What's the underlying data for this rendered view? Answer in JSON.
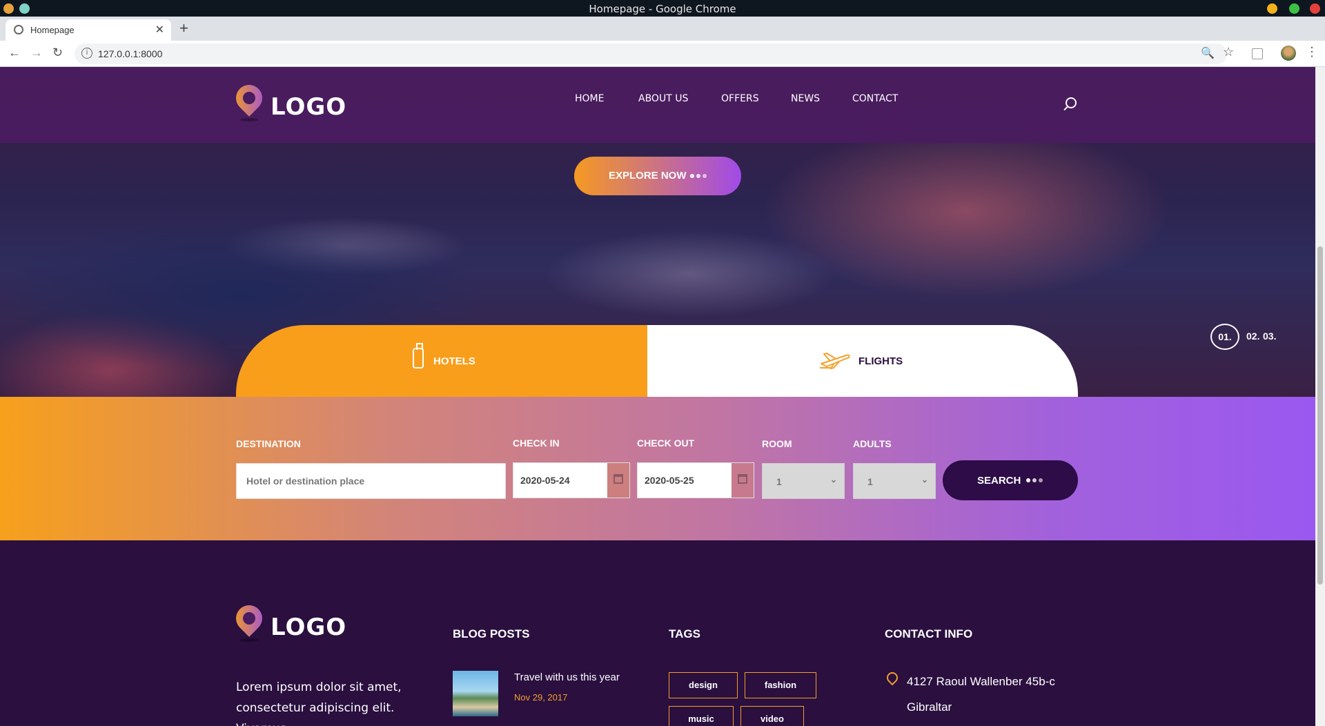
{
  "window": {
    "title": "Homepage - Google Chrome"
  },
  "browser": {
    "tab_title": "Homepage",
    "tab_close": "✕",
    "new_tab": "+",
    "url": "127.0.0.1:8000",
    "back": "←",
    "forward": "→",
    "reload": "↻",
    "zoom": "🔍",
    "star": "☆",
    "menu": "⋮"
  },
  "header": {
    "logo_text": "LOGO",
    "nav": [
      "HOME",
      "ABOUT US",
      "OFFERS",
      "NEWS",
      "CONTACT"
    ]
  },
  "hero": {
    "explore_label": "EXPLORE NOW",
    "slides": [
      "01.",
      "02.",
      "03."
    ]
  },
  "booking_tabs": {
    "hotels": "HOTELS",
    "flights": "FLIGHTS"
  },
  "search_form": {
    "destination_label": "DESTINATION",
    "destination_placeholder": "Hotel or destination place",
    "checkin_label": "CHECK IN",
    "checkin_value": "2020-05-24",
    "checkout_label": "CHECK OUT",
    "checkout_value": "2020-05-25",
    "room_label": "ROOM",
    "room_value": "1",
    "adults_label": "ADULTS",
    "adults_value": "1",
    "search_label": "SEARCH"
  },
  "footer": {
    "logo_text": "LOGO",
    "about_text": "Lorem ipsum dolor sit amet, consectetur adipiscing elit. Vivamus",
    "blog_heading": "BLOG POSTS",
    "blog_post_title": "Travel with us this year",
    "blog_post_date": "Nov 29, 2017",
    "tags_heading": "TAGS",
    "tags": [
      "design",
      "fashion",
      "music",
      "video"
    ],
    "contact_heading": "CONTACT INFO",
    "address_line1": "4127 Raoul Wallenber 45b-c",
    "address_line2": "Gibraltar"
  },
  "colors": {
    "accent_orange": "#f99e1b",
    "accent_purple": "#9b58f0",
    "footer_bg": "#2a0f3f",
    "header_bg": "#4a1c60"
  }
}
